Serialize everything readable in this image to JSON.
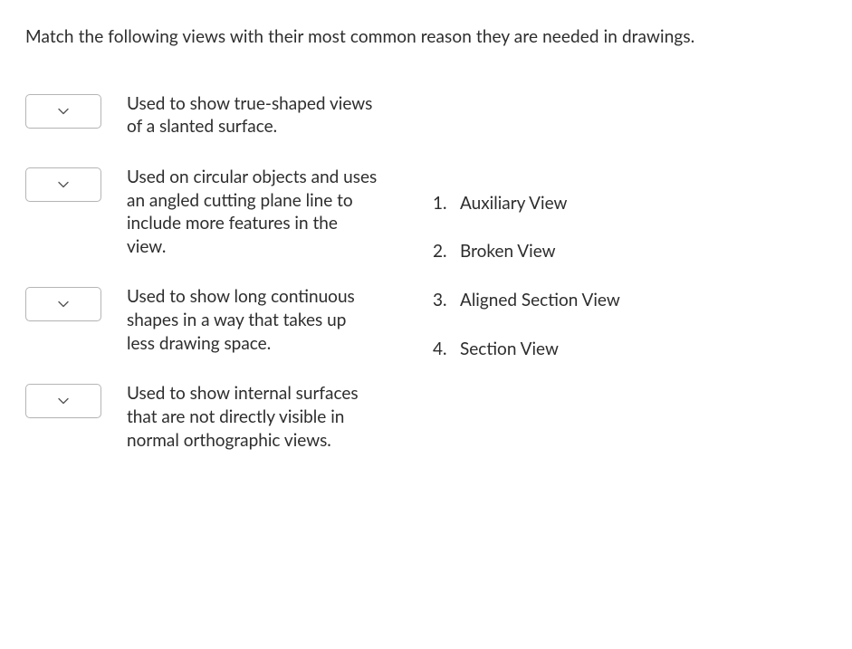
{
  "question": "Match the following views with their most common reason they are needed in drawings.",
  "prompts": [
    {
      "text": "Used to show true-shaped views of a slanted surface."
    },
    {
      "text": "Used on circular objects and uses an angled cutting plane line to include more features in the view."
    },
    {
      "text": "Used to show long continuous shapes in a way that takes up less drawing space."
    },
    {
      "text": "Used to show internal surfaces that are not directly visible in normal orthographic views."
    }
  ],
  "options": [
    {
      "num": "1.",
      "label": "Auxiliary View"
    },
    {
      "num": "2.",
      "label": "Broken View"
    },
    {
      "num": "3.",
      "label": "Aligned Section View"
    },
    {
      "num": "4.",
      "label": "Section View"
    }
  ]
}
